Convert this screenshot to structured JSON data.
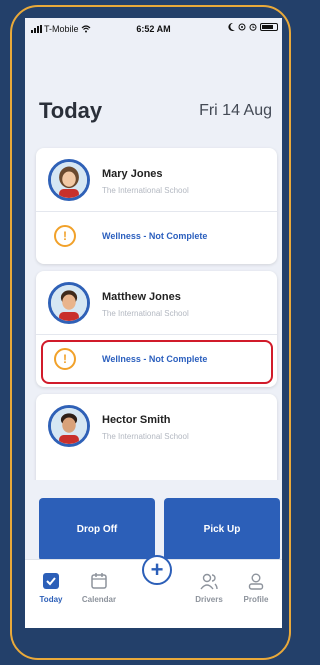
{
  "status_bar": {
    "carrier": "T-Mobile",
    "time": "6:52 AM"
  },
  "header": {
    "title": "Today",
    "date": "Fri 14 Aug"
  },
  "children": [
    {
      "name": "Mary Jones",
      "school": "The International School",
      "status": "Wellness - Not Complete"
    },
    {
      "name": "Matthew Jones",
      "school": "The International School",
      "status": "Wellness - Not Complete"
    },
    {
      "name": "Hector Smith",
      "school": "The International School"
    }
  ],
  "actions": {
    "drop_off": "Drop Off",
    "pick_up": "Pick Up"
  },
  "tabbar": {
    "today": "Today",
    "calendar": "Calendar",
    "add": "+",
    "drivers": "Drivers",
    "profile": "Profile"
  },
  "colors": {
    "background": "#23406a",
    "frame": "#e9a93a",
    "accent": "#2c5fb8",
    "warning": "#f1a12a",
    "highlight": "#d11b2a"
  }
}
